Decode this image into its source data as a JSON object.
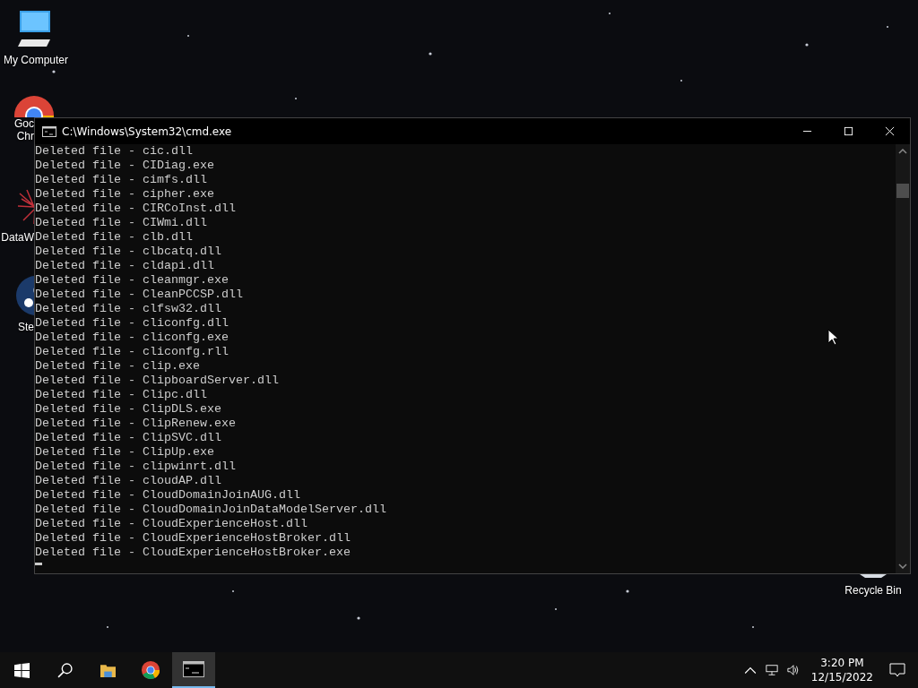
{
  "desktop_icons": [
    {
      "kind": "computer",
      "label_lines": [
        "My Computer"
      ]
    },
    {
      "kind": "chrome",
      "label_lines": [
        "Goc",
        "Chr"
      ]
    },
    {
      "kind": "web",
      "label_lines": [
        "DataW"
      ]
    },
    {
      "kind": "steam",
      "label_lines": [
        "Ste"
      ]
    },
    {
      "kind": "recycle",
      "label_lines": [
        "Recycle Bin"
      ]
    }
  ],
  "window": {
    "title": "C:\\Windows\\System32\\cmd.exe",
    "lines": [
      "Deleted file - cic.dll",
      "Deleted file - CIDiag.exe",
      "Deleted file - cimfs.dll",
      "Deleted file - cipher.exe",
      "Deleted file - CIRCoInst.dll",
      "Deleted file - CIWmi.dll",
      "Deleted file - clb.dll",
      "Deleted file - clbcatq.dll",
      "Deleted file - cldapi.dll",
      "Deleted file - cleanmgr.exe",
      "Deleted file - CleanPCCSP.dll",
      "Deleted file - clfsw32.dll",
      "Deleted file - cliconfg.dll",
      "Deleted file - cliconfg.exe",
      "Deleted file - cliconfg.rll",
      "Deleted file - clip.exe",
      "Deleted file - ClipboardServer.dll",
      "Deleted file - Clipc.dll",
      "Deleted file - ClipDLS.exe",
      "Deleted file - ClipRenew.exe",
      "Deleted file - ClipSVC.dll",
      "Deleted file - ClipUp.exe",
      "Deleted file - clipwinrt.dll",
      "Deleted file - cloudAP.dll",
      "Deleted file - CloudDomainJoinAUG.dll",
      "Deleted file - CloudDomainJoinDataModelServer.dll",
      "Deleted file - CloudExperienceHost.dll",
      "Deleted file - CloudExperienceHostBroker.dll",
      "Deleted file - CloudExperienceHostBroker.exe"
    ]
  },
  "taskbar": {
    "items": [
      {
        "kind": "start",
        "selected": false
      },
      {
        "kind": "search",
        "selected": false
      },
      {
        "kind": "explorer",
        "selected": false
      },
      {
        "kind": "chrome",
        "selected": false
      },
      {
        "kind": "console",
        "selected": true
      }
    ],
    "clock": {
      "time": "3:20 PM",
      "date": "12/15/2022"
    }
  }
}
